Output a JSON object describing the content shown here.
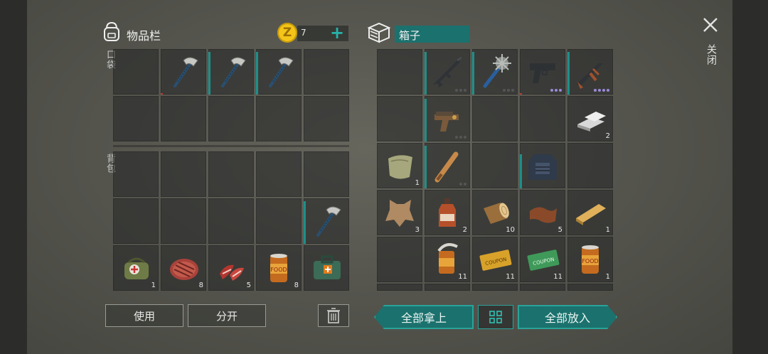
{
  "inventory": {
    "title": "物品栏",
    "coins": "7",
    "pocket_label": "口袋",
    "backpack_label": "背包",
    "slots": [
      {
        "icon": "empty"
      },
      {
        "icon": "hatchet-icon",
        "durability": 0.04
      },
      {
        "icon": "hatchet-icon",
        "durability": 1.0
      },
      {
        "icon": "hatchet-icon",
        "durability": 1.0
      },
      {
        "icon": "empty"
      },
      {
        "icon": "empty"
      },
      {
        "icon": "empty"
      },
      {
        "icon": "empty"
      },
      {
        "icon": "empty"
      },
      {
        "icon": "empty"
      },
      {
        "icon": "empty"
      },
      {
        "icon": "empty"
      },
      {
        "icon": "empty"
      },
      {
        "icon": "empty"
      },
      {
        "icon": "empty"
      },
      {
        "icon": "empty"
      },
      {
        "icon": "empty"
      },
      {
        "icon": "empty"
      },
      {
        "icon": "empty"
      },
      {
        "icon": "hatchet-icon",
        "durability": 1.0
      },
      {
        "icon": "first-aid-bag-icon",
        "qty": "1"
      },
      {
        "icon": "steak-icon",
        "qty": "8"
      },
      {
        "icon": "raw-meat-icon",
        "qty": "5"
      },
      {
        "icon": "canned-food-icon",
        "qty": "8"
      },
      {
        "icon": "medkit-icon"
      }
    ]
  },
  "chest": {
    "title": "箱子",
    "slots": [
      {
        "icon": "empty"
      },
      {
        "icon": "rifle-icon",
        "durability": 1.0,
        "dots": [
          "g",
          "g",
          "g"
        ]
      },
      {
        "icon": "spiked-mace-icon",
        "durability": 1.0,
        "dots": [
          "g",
          "g",
          "g"
        ]
      },
      {
        "icon": "pistol-icon",
        "durability": 0.0,
        "dots": [
          "p",
          "p",
          "p"
        ]
      },
      {
        "icon": "ak-rifle-icon",
        "durability": 1.0,
        "dots": [
          "p",
          "p",
          "p",
          "p"
        ]
      },
      {
        "icon": "empty"
      },
      {
        "icon": "crossbow-pistol-icon",
        "durability": 1.0,
        "dots": [
          "g",
          "g",
          "g"
        ]
      },
      {
        "icon": "empty"
      },
      {
        "icon": "empty"
      },
      {
        "icon": "iron-bars-icon",
        "qty": "2"
      },
      {
        "icon": "cloth-icon",
        "qty": "1"
      },
      {
        "icon": "baseball-bat-icon",
        "durability": 1.0,
        "dots": [
          "g",
          "g"
        ]
      },
      {
        "icon": "empty"
      },
      {
        "icon": "body-armor-icon",
        "durability": 0.8
      },
      {
        "icon": "empty"
      },
      {
        "icon": "animal-hide-icon",
        "qty": "3"
      },
      {
        "icon": "bottle-icon",
        "qty": "2"
      },
      {
        "icon": "log-icon",
        "qty": "10"
      },
      {
        "icon": "leather-icon",
        "qty": "5"
      },
      {
        "icon": "wood-plank-icon",
        "qty": "1"
      },
      {
        "icon": "empty"
      },
      {
        "icon": "opened-can-icon",
        "qty": "11"
      },
      {
        "icon": "coupon-yellow-icon",
        "qty": "11"
      },
      {
        "icon": "coupon-green-icon",
        "qty": "11"
      },
      {
        "icon": "canned-food-icon",
        "qty": "1"
      }
    ]
  },
  "buttons": {
    "use": "使用",
    "split": "分开",
    "take_all": "全部拿上",
    "put_all": "全部放入"
  },
  "close": {
    "label": "关闭"
  },
  "colors": {
    "accent": "#1b716d",
    "accent_light": "#2aa39a",
    "coin": "#f4c418",
    "durability": "#1d8f8a"
  }
}
